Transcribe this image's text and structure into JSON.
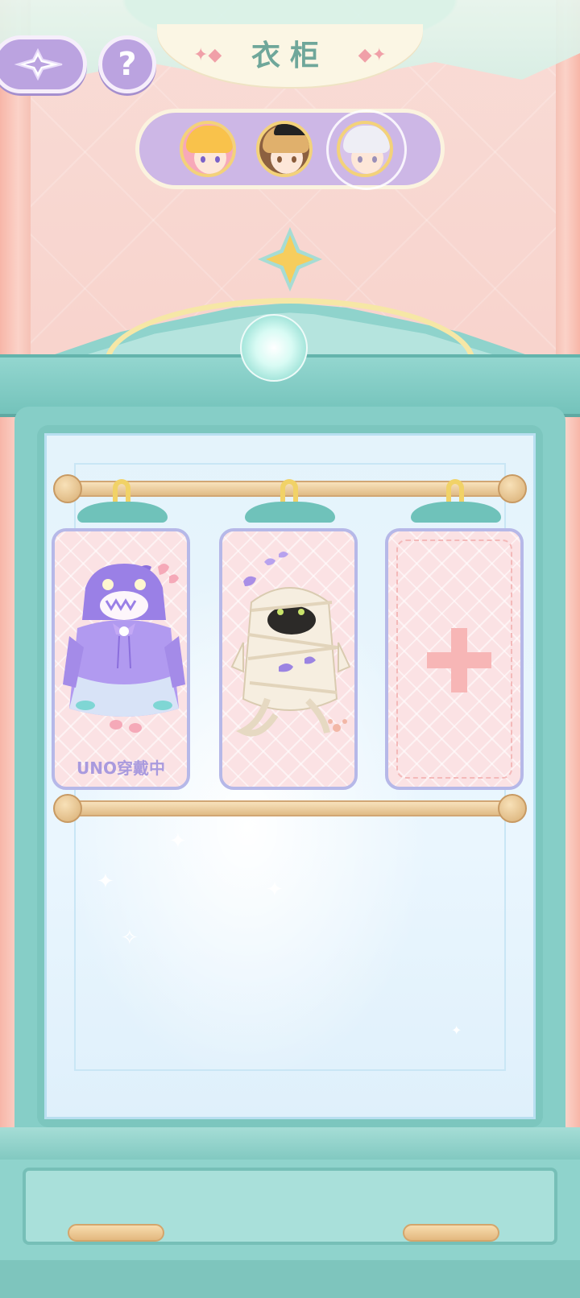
{
  "header": {
    "title": "衣柜",
    "back_icon": "sparkle-arrow-left-icon",
    "help_label": "?"
  },
  "characters": [
    {
      "name": "blonde-girl",
      "selected": false
    },
    {
      "name": "brown-hair-boy",
      "selected": false
    },
    {
      "name": "silver-hair-girl",
      "selected": true
    }
  ],
  "wardrobe": {
    "slots": [
      {
        "outfit": "purple-monster-hoodie",
        "label": "UNO穿戴中",
        "equipped": true
      },
      {
        "outfit": "mummy-costume",
        "label": "",
        "equipped": false
      },
      {
        "outfit": "empty",
        "label": "",
        "equipped": false
      }
    ]
  },
  "colors": {
    "accent_purple": "#bba3e0",
    "wardrobe_teal": "#8fd3cc",
    "title_green": "#6fa79a",
    "card_label": "#a99ade"
  }
}
